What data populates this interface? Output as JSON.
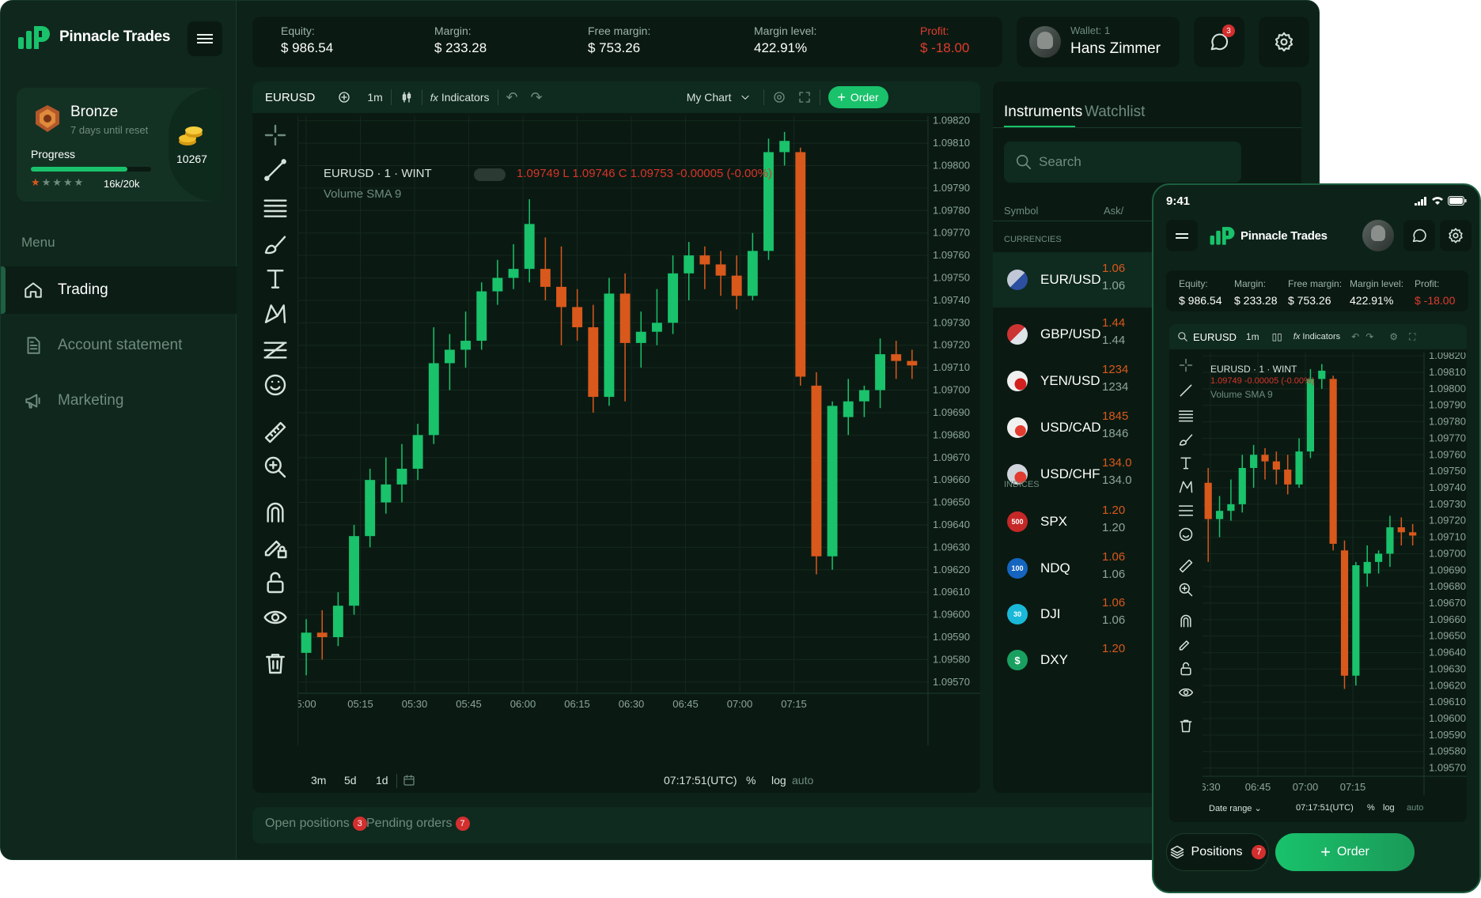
{
  "brand": {
    "name": "Pinnacle Trades",
    "accent": "#19c26b",
    "bull": "#19c26b",
    "bear": "#d9581c"
  },
  "rank": {
    "tier": "Bronze",
    "reset": "7 days until reset",
    "progress_label": "Progress",
    "progress_text": "16k/20k",
    "progress": 0.8,
    "coins": "10267"
  },
  "menu": {
    "title": "Menu",
    "items": [
      {
        "label": "Trading",
        "icon": "home-icon"
      },
      {
        "label": "Account statement",
        "icon": "document-icon"
      },
      {
        "label": "Marketing",
        "icon": "megaphone-icon"
      }
    ]
  },
  "stats": [
    {
      "label": "Equity:",
      "value": "$ 986.54"
    },
    {
      "label": "Margin:",
      "value": "$ 233.28"
    },
    {
      "label": "Free margin:",
      "value": "$ 753.26"
    },
    {
      "label": "Margin level:",
      "value": "422.91%"
    },
    {
      "label": "Profit:",
      "value": "$ -18.00"
    }
  ],
  "wallet": {
    "label": "Wallet: 1",
    "name": "Hans Zimmer",
    "notifications": "3"
  },
  "chart_toolbar": {
    "symbol": "EURUSD",
    "interval": "1m",
    "indicators": "Indicators",
    "layout": "My Chart",
    "order": "Order"
  },
  "chart_legend": {
    "title": "EURUSD · 1 · WINT",
    "ohlc": "1.09749 L 1.09746 C 1.09753 -0.00005 (-0.00%)",
    "mobile_ohlc": "1.09749 -0.00005 (-0.00%)",
    "volume": "Volume SMA 9"
  },
  "chart_footer": {
    "ranges": [
      "3m",
      "5d",
      "1d"
    ],
    "time": "07:17:51(UTC)",
    "pct": "%",
    "log": "log",
    "auto": "auto",
    "date_range": "Date range"
  },
  "instruments": {
    "tabs": [
      "Instruments",
      "Watchlist"
    ],
    "search_placeholder": "Search",
    "cols": [
      "Symbol",
      "Ask/"
    ],
    "groups": [
      {
        "name": "CURRENCIES",
        "items": [
          {
            "symbol": "EUR/USD",
            "ask": "1.06",
            "bid": "1.06"
          },
          {
            "symbol": "GBP/USD",
            "ask": "1.44",
            "bid": "1.44"
          },
          {
            "symbol": "YEN/USD",
            "ask": "1234",
            "bid": "1234"
          },
          {
            "symbol": "USD/CAD",
            "ask": "1845",
            "bid": "1846"
          },
          {
            "symbol": "USD/CHF",
            "ask": "134.0",
            "bid": "134.0"
          }
        ]
      },
      {
        "name": "INDICES",
        "items": [
          {
            "symbol": "SPX",
            "badge": "500",
            "ask": "1.20",
            "bid": "1.20"
          },
          {
            "symbol": "NDQ",
            "badge": "100",
            "ask": "1.06",
            "bid": "1.06"
          },
          {
            "symbol": "DJI",
            "badge": "30",
            "ask": "1.06",
            "bid": "1.06"
          },
          {
            "symbol": "DXY",
            "badge": "$",
            "ask": "1.20",
            "bid": ""
          }
        ]
      }
    ]
  },
  "bottom": {
    "open_positions": "Open positions",
    "open_count": "3",
    "pending_orders": "Pending orders",
    "pending_count": "7"
  },
  "mobile": {
    "time": "9:41",
    "positions": "Positions",
    "positions_count": "7",
    "order": "Order"
  },
  "chart_data": {
    "type": "candlestick",
    "title": "EURUSD · 1 · WINT",
    "y_ticks": [
      "1.09820",
      "1.09810",
      "1.09800",
      "1.09790",
      "1.09780",
      "1.09770",
      "1.09760",
      "1.09750",
      "1.09740",
      "1.09730",
      "1.09720",
      "1.09710",
      "1.09700",
      "1.09690",
      "1.09680",
      "1.09670",
      "1.09660",
      "1.09650",
      "1.09640",
      "1.09630",
      "1.09620",
      "1.09610",
      "1.09600",
      "1.09590",
      "1.09580",
      "1.09570"
    ],
    "x_ticks": [
      "5:00",
      "05:15",
      "05:30",
      "05:45",
      "06:00",
      "06:15",
      "06:30",
      "06:45",
      "07:00",
      "07:15"
    ],
    "mobile_x_ticks": [
      "6:30",
      "06:45",
      "07:00",
      "07:15"
    ],
    "ylim": [
      1.09565,
      1.09822
    ],
    "candles": [
      [
        1.09583,
        1.09598,
        1.09573,
        1.09592
      ],
      [
        1.09592,
        1.09602,
        1.0958,
        1.0959
      ],
      [
        1.0959,
        1.0961,
        1.09586,
        1.09604
      ],
      [
        1.09604,
        1.0964,
        1.096,
        1.09635
      ],
      [
        1.09635,
        1.09665,
        1.0963,
        1.0966
      ],
      [
        1.0965,
        1.0967,
        1.09645,
        1.09658
      ],
      [
        1.09658,
        1.09676,
        1.0965,
        1.09665
      ],
      [
        1.09665,
        1.09685,
        1.0966,
        1.0968
      ],
      [
        1.0968,
        1.09728,
        1.09676,
        1.09712
      ],
      [
        1.09712,
        1.09725,
        1.097,
        1.09718
      ],
      [
        1.09718,
        1.09735,
        1.0971,
        1.09722
      ],
      [
        1.09722,
        1.09748,
        1.09718,
        1.09744
      ],
      [
        1.09744,
        1.09758,
        1.09738,
        1.0975
      ],
      [
        1.0975,
        1.09765,
        1.09745,
        1.09754
      ],
      [
        1.09754,
        1.09785,
        1.09748,
        1.09774
      ],
      [
        1.09754,
        1.09768,
        1.0974,
        1.09746
      ],
      [
        1.09746,
        1.09764,
        1.0972,
        1.09737
      ],
      [
        1.09737,
        1.09745,
        1.09722,
        1.09728
      ],
      [
        1.09728,
        1.09738,
        1.0969,
        1.09697
      ],
      [
        1.09697,
        1.0975,
        1.09693,
        1.09743
      ],
      [
        1.09743,
        1.09752,
        1.09695,
        1.09721
      ],
      [
        1.09721,
        1.09735,
        1.0971,
        1.09726
      ],
      [
        1.09726,
        1.09745,
        1.0972,
        1.0973
      ],
      [
        1.0973,
        1.0976,
        1.09725,
        1.09752
      ],
      [
        1.09752,
        1.09766,
        1.0974,
        1.0976
      ],
      [
        1.0976,
        1.09764,
        1.09745,
        1.09756
      ],
      [
        1.09756,
        1.09762,
        1.09742,
        1.09751
      ],
      [
        1.09751,
        1.0976,
        1.09736,
        1.09742
      ],
      [
        1.09742,
        1.0977,
        1.0974,
        1.09762
      ],
      [
        1.09762,
        1.09812,
        1.09758,
        1.09806
      ],
      [
        1.09806,
        1.09815,
        1.098,
        1.09811
      ],
      [
        1.09806,
        1.09808,
        1.09702,
        1.09706
      ],
      [
        1.09702,
        1.09708,
        1.09618,
        1.09626
      ],
      [
        1.09626,
        1.09695,
        1.0962,
        1.09693
      ],
      [
        1.09688,
        1.09705,
        1.0968,
        1.09695
      ],
      [
        1.09695,
        1.09702,
        1.09688,
        1.097
      ],
      [
        1.097,
        1.09723,
        1.09692,
        1.09716
      ],
      [
        1.09716,
        1.09722,
        1.09705,
        1.09713
      ],
      [
        1.09713,
        1.09718,
        1.09705,
        1.09711
      ]
    ]
  }
}
